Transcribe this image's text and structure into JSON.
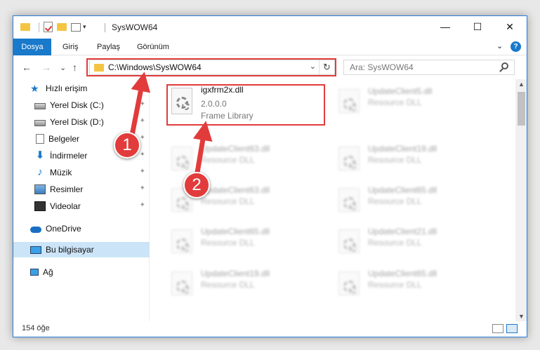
{
  "window": {
    "title": "SysWOW64",
    "controls": {
      "minimize": "—",
      "maximize": "☐",
      "close": "✕"
    }
  },
  "ribbon": {
    "tabs": [
      {
        "label": "Dosya",
        "active": true
      },
      {
        "label": "Giriş"
      },
      {
        "label": "Paylaş"
      },
      {
        "label": "Görünüm"
      }
    ],
    "expand": "⌄",
    "help": "?"
  },
  "nav": {
    "back": "←",
    "forward": "→",
    "recent": "⌄",
    "up": "↑",
    "address": "C:\\Windows\\SysWOW64",
    "dropdown": "⌄",
    "refresh": "↻",
    "search_placeholder": "Ara: SysWOW64"
  },
  "sidebar": {
    "items": [
      {
        "label": "Hızlı erişim",
        "icon": "star-icon"
      },
      {
        "label": "Yerel Disk (C:)",
        "icon": "disk-icon",
        "pinned": true
      },
      {
        "label": "Yerel Disk (D:)",
        "icon": "disk-icon",
        "pinned": true
      },
      {
        "label": "Belgeler",
        "icon": "document-icon",
        "pinned": true
      },
      {
        "label": "İndirmeler",
        "icon": "download-icon",
        "pinned": true
      },
      {
        "label": "Müzik",
        "icon": "music-icon",
        "pinned": true
      },
      {
        "label": "Resimler",
        "icon": "pictures-icon",
        "pinned": true
      },
      {
        "label": "Videolar",
        "icon": "videos-icon",
        "pinned": true
      },
      {
        "label": "OneDrive",
        "icon": "cloud-icon"
      },
      {
        "label": "Bu bilgisayar",
        "icon": "computer-icon",
        "selected": true
      },
      {
        "label": "Ağ",
        "icon": "network-icon"
      }
    ]
  },
  "files": {
    "highlighted": {
      "name": "igxfrm2x.dll",
      "version": "2.0.0.0",
      "type": "Frame Library"
    },
    "blurred": [
      {
        "name": "UpdateClient5.dll",
        "type": "Resource DLL"
      },
      {
        "name": "UpdateClient63.dll",
        "type": "Resource DLL"
      },
      {
        "name": "UpdateClient19.dll",
        "type": "Resource DLL"
      },
      {
        "name": "UpdateClient63.dll",
        "type": "Resource DLL"
      },
      {
        "name": "UpdateClient65.dll",
        "type": "Resource DLL"
      },
      {
        "name": "UpdateClient65.dll",
        "type": "Resource DLL"
      },
      {
        "name": "UpdateClient21.dll",
        "type": "Resource DLL"
      },
      {
        "name": "UpdateClient19.dll",
        "type": "Resource DLL"
      },
      {
        "name": "UpdateClient65.dll",
        "type": "Resource DLL"
      }
    ]
  },
  "status": {
    "count": "154 öğe"
  },
  "annotations": {
    "step1": "1",
    "step2": "2",
    "color": "#e23b3b"
  },
  "colors": {
    "accent": "#1979ca",
    "selection": "#cce4f7",
    "folder": "#f4c542"
  }
}
